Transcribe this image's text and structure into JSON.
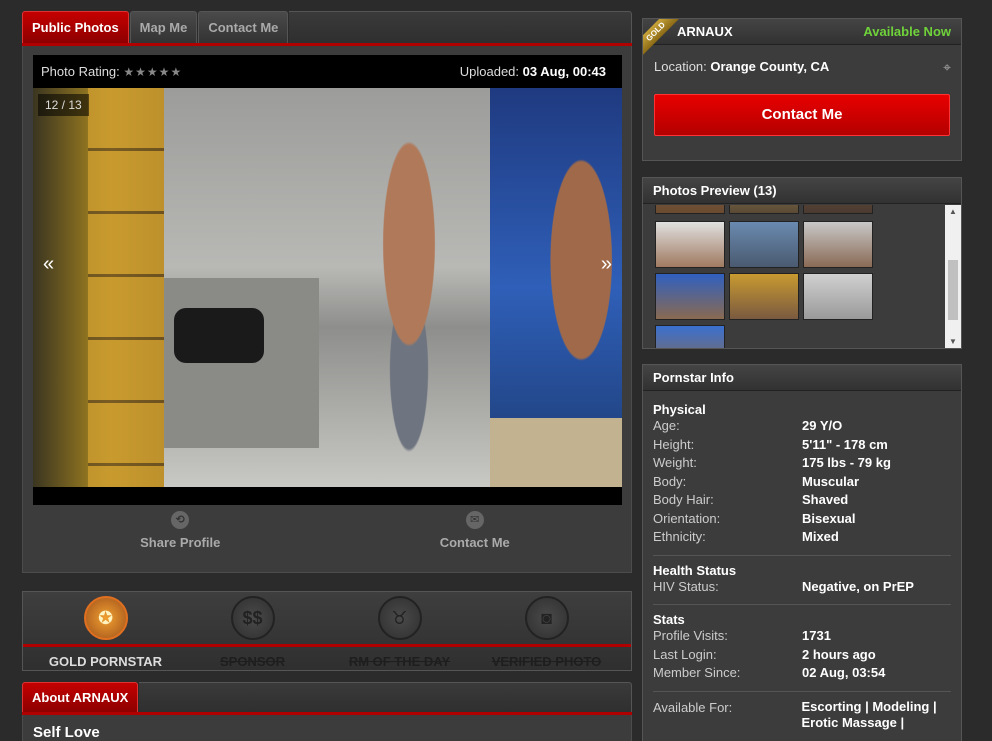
{
  "tabs": [
    "Public Photos",
    "Map Me",
    "Contact Me"
  ],
  "viewer": {
    "rating_label": "Photo Rating:",
    "stars": "★★★★★",
    "uploaded_label": "Uploaded:",
    "uploaded_value": "03 Aug, 00:43",
    "counter": "12 / 13",
    "prev": "«",
    "next": "»"
  },
  "actions": {
    "share_label": "Share Profile",
    "contact_label": "Contact Me"
  },
  "badges": [
    {
      "label": "GOLD PORNSTAR",
      "active": true,
      "icon": "award-icon"
    },
    {
      "label": "SPONSOR",
      "active": false,
      "icon": "dollar-icon"
    },
    {
      "label": "RM OF THE DAY",
      "active": false,
      "icon": "horns-icon"
    },
    {
      "label": "VERIFIED PHOTO",
      "active": false,
      "icon": "camera-icon"
    }
  ],
  "about": {
    "tab": "About ARNAUX",
    "heading": "Self Love"
  },
  "profile": {
    "ribbon": "GOLD",
    "name": "ARNAUX",
    "status": "Available Now",
    "location_label": "Location:",
    "location_value": "Orange County, CA",
    "contact_button": "Contact Me"
  },
  "preview": {
    "title": "Photos Preview (13)"
  },
  "info": {
    "title": "Pornstar Info",
    "physical_title": "Physical",
    "physical": [
      {
        "k": "Age:",
        "v": "29 Y/O"
      },
      {
        "k": "Height:",
        "v": "5'11\" - 178 cm"
      },
      {
        "k": "Weight:",
        "v": "175 lbs - 79 kg"
      },
      {
        "k": "Body:",
        "v": "Muscular"
      },
      {
        "k": "Body Hair:",
        "v": "Shaved"
      },
      {
        "k": "Orientation:",
        "v": "Bisexual"
      },
      {
        "k": "Ethnicity:",
        "v": "Mixed"
      }
    ],
    "health_title": "Health Status",
    "health": [
      {
        "k": "HIV Status:",
        "v": "Negative, on PrEP"
      }
    ],
    "stats_title": "Stats",
    "stats": [
      {
        "k": "Profile Visits:",
        "v": "1731"
      },
      {
        "k": "Last Login:",
        "v": "2 hours ago"
      },
      {
        "k": "Member Since:",
        "v": "02 Aug, 03:54"
      }
    ],
    "available_label": "Available For:",
    "available_value": "Escorting | Modeling | Erotic Massage |"
  },
  "colors": {
    "accent_red": "#c40000",
    "available_green": "#6fd23a",
    "gold": "#c9a43a"
  }
}
